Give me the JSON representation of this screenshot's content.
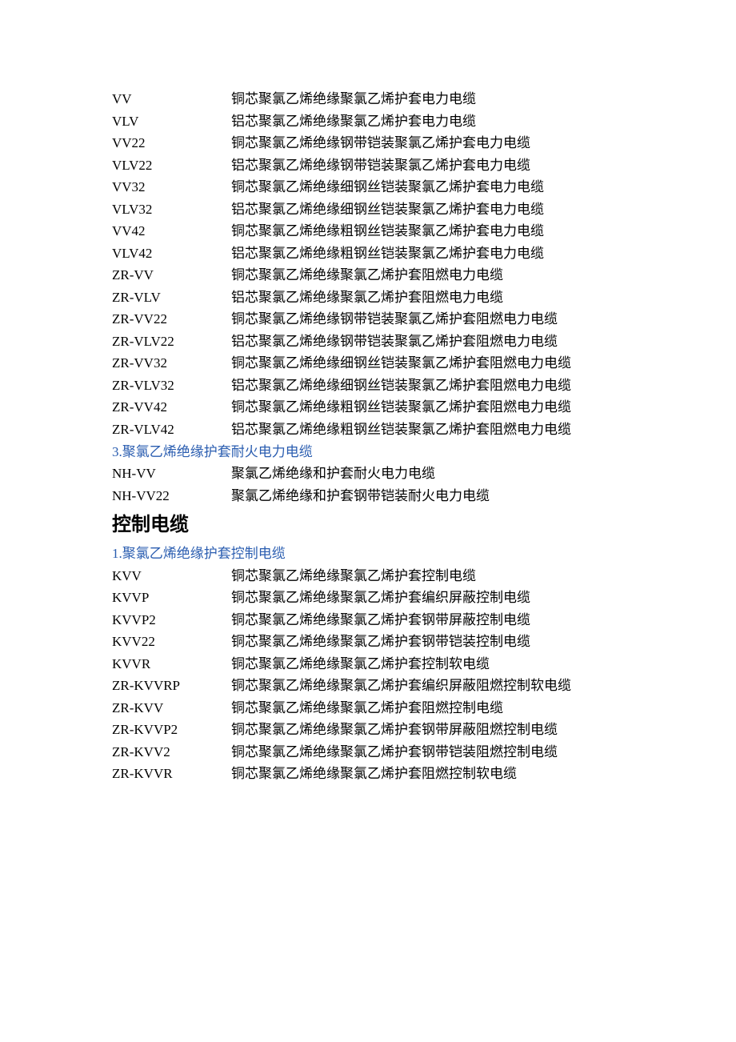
{
  "sections": [
    {
      "rows": [
        {
          "code": "VV",
          "desc": "铜芯聚氯乙烯绝缘聚氯乙烯护套电力电缆"
        },
        {
          "code": "VLV",
          "desc": "铝芯聚氯乙烯绝缘聚氯乙烯护套电力电缆"
        },
        {
          "code": "VV22",
          "desc": "铜芯聚氯乙烯绝缘钢带铠装聚氯乙烯护套电力电缆"
        },
        {
          "code": "VLV22",
          "desc": "铝芯聚氯乙烯绝缘钢带铠装聚氯乙烯护套电力电缆"
        },
        {
          "code": "VV32",
          "desc": "铜芯聚氯乙烯绝缘细钢丝铠装聚氯乙烯护套电力电缆"
        },
        {
          "code": "VLV32",
          "desc": "铝芯聚氯乙烯绝缘细钢丝铠装聚氯乙烯护套电力电缆"
        },
        {
          "code": "VV42",
          "desc": "铜芯聚氯乙烯绝缘粗钢丝铠装聚氯乙烯护套电力电缆"
        },
        {
          "code": "VLV42",
          "desc": "铝芯聚氯乙烯绝缘粗钢丝铠装聚氯乙烯护套电力电缆"
        },
        {
          "code": "ZR-VV",
          "desc": "铜芯聚氯乙烯绝缘聚氯乙烯护套阻燃电力电缆"
        },
        {
          "code": "ZR-VLV",
          "desc": "铝芯聚氯乙烯绝缘聚氯乙烯护套阻燃电力电缆"
        },
        {
          "code": "ZR-VV22",
          "desc": "铜芯聚氯乙烯绝缘钢带铠装聚氯乙烯护套阻燃电力电缆"
        },
        {
          "code": "ZR-VLV22",
          "desc": "铝芯聚氯乙烯绝缘钢带铠装聚氯乙烯护套阻燃电力电缆"
        },
        {
          "code": "ZR-VV32",
          "desc": "铜芯聚氯乙烯绝缘细钢丝铠装聚氯乙烯护套阻燃电力电缆"
        },
        {
          "code": "ZR-VLV32",
          "desc": "铝芯聚氯乙烯绝缘细钢丝铠装聚氯乙烯护套阻燃电力电缆"
        },
        {
          "code": "ZR-VV42",
          "desc": "铜芯聚氯乙烯绝缘粗钢丝铠装聚氯乙烯护套阻燃电力电缆"
        },
        {
          "code": "ZR-VLV42",
          "desc": "铝芯聚氯乙烯绝缘粗钢丝铠装聚氯乙烯护套阻燃电力电缆"
        }
      ]
    },
    {
      "sub_heading": "3.聚氯乙烯绝缘护套耐火电力电缆",
      "rows": [
        {
          "code": "NH-VV",
          "desc": "聚氯乙烯绝缘和护套耐火电力电缆"
        },
        {
          "code": "NH-VV22",
          "desc": "聚氯乙烯绝缘和护套钢带铠装耐火电力电缆"
        }
      ]
    },
    {
      "main_heading": "控制电缆",
      "sub_heading": "1.聚氯乙烯绝缘护套控制电缆",
      "rows": [
        {
          "code": "KVV",
          "desc": "铜芯聚氯乙烯绝缘聚氯乙烯护套控制电缆"
        },
        {
          "code": "KVVP",
          "desc": "铜芯聚氯乙烯绝缘聚氯乙烯护套编织屏蔽控制电缆"
        },
        {
          "code": "KVVP2",
          "desc": "铜芯聚氯乙烯绝缘聚氯乙烯护套钢带屏蔽控制电缆"
        },
        {
          "code": "KVV22",
          "desc": "铜芯聚氯乙烯绝缘聚氯乙烯护套钢带铠装控制电缆"
        },
        {
          "code": "KVVR",
          "desc": "铜芯聚氯乙烯绝缘聚氯乙烯护套控制软电缆"
        },
        {
          "code": "ZR-KVVRP",
          "desc": "铜芯聚氯乙烯绝缘聚氯乙烯护套编织屏蔽阻燃控制软电缆"
        },
        {
          "code": "ZR-KVV",
          "desc": "铜芯聚氯乙烯绝缘聚氯乙烯护套阻燃控制电缆"
        },
        {
          "code": "ZR-KVVP2",
          "desc": "铜芯聚氯乙烯绝缘聚氯乙烯护套钢带屏蔽阻燃控制电缆"
        },
        {
          "code": "ZR-KVV2",
          "desc": "铜芯聚氯乙烯绝缘聚氯乙烯护套钢带铠装阻燃控制电缆"
        },
        {
          "code": "ZR-KVVR",
          "desc": "铜芯聚氯乙烯绝缘聚氯乙烯护套阻燃控制软电缆"
        }
      ]
    }
  ]
}
